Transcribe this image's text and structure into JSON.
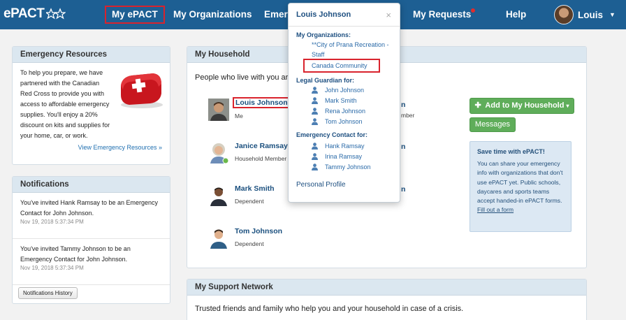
{
  "nav": {
    "logo": "ePACT",
    "items": [
      {
        "label": "My ePACT"
      },
      {
        "label": "My Organizations"
      },
      {
        "label": "Emerg"
      },
      {
        "label": "My Requests"
      },
      {
        "label": "Help"
      }
    ],
    "user_name": "Louis"
  },
  "emergency_resources": {
    "title": "Emergency Resources",
    "text": "To help you prepare, we have partnered with the Canadian Red Cross to provide you with access to affordable emergency supplies. You'll enjoy a 20% discount on kits and supplies for your home, car, or work.",
    "link": "View Emergency Resources »"
  },
  "notifications": {
    "title": "Notifications",
    "items": [
      {
        "text": "You've invited Hank Ramsay to be an Emergency Contact for John Johnson.",
        "time": "Nov 19, 2018 5:37:34 PM"
      },
      {
        "text": "You've invited Tammy Johnson to be an Emergency Contact for John Johnson.",
        "time": "Nov 19, 2018 5:37:34 PM"
      }
    ],
    "history_button": "Notifications History"
  },
  "household": {
    "title": "My Household",
    "intro": "People who live with you ar",
    "members": [
      {
        "name": "Louis Johnson",
        "role": "Me"
      },
      {
        "name": "Janice Ramsay",
        "role": "Household Member"
      },
      {
        "name": "Mark Smith",
        "role": "Dependent"
      },
      {
        "name": "Tom Johnson",
        "role": "Dependent"
      }
    ],
    "peek": {
      "frag1": "n",
      "role1": "mber",
      "frag2": "n",
      "frag3": "n"
    },
    "add_button": "Add to My Household",
    "messages_button": "Messages",
    "promo": {
      "title": "Save time with ePACT!",
      "text": "You can share your emergency info with organizations that don't use ePACT yet. Public schools, daycares and sports teams accept handed-in ePACT forms.",
      "link": "Fill out a form"
    }
  },
  "support_network": {
    "title": "My Support Network",
    "text": "Trusted friends and family who help you and your household in case of a crisis."
  },
  "user_dropdown": {
    "title": "Louis Johnson",
    "close": "×",
    "orgs_label": "My Organizations:",
    "orgs": [
      "**City of Prana Recreation -",
      "Staff",
      "Canada Community"
    ],
    "guardian_label": "Legal Guardian for:",
    "guardian_for": [
      "John Johnson",
      "Mark Smith",
      "Rena Johnson",
      "Tom Johnson"
    ],
    "emergency_label": "Emergency Contact for:",
    "emergency_for": [
      "Hank Ramsay",
      "Irina Ramsay",
      "Tammy Johnson"
    ],
    "profile": "Personal Profile"
  },
  "colors": {
    "nav_bg": "#1d5f93",
    "panel_head": "#dbe7f0",
    "highlight": "#d9232d",
    "green": "#5fad5a"
  }
}
